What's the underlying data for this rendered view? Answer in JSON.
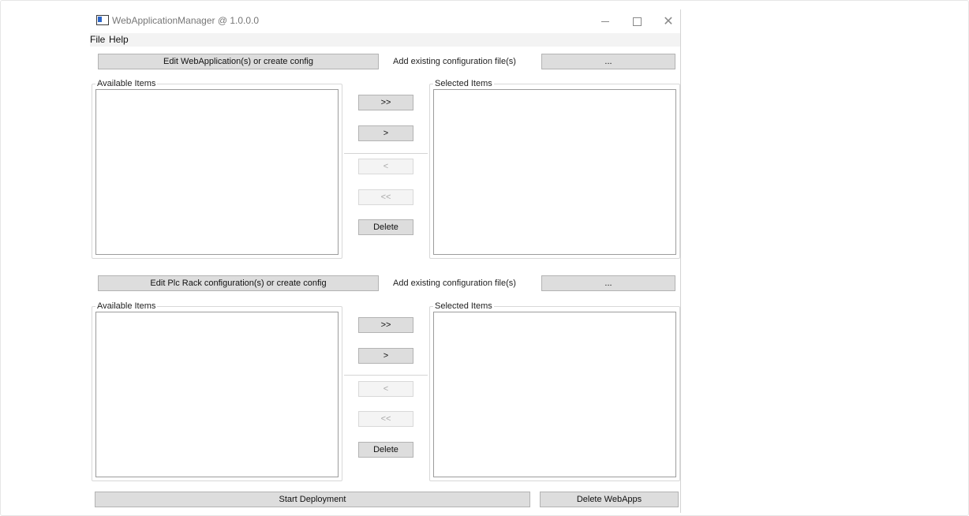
{
  "window": {
    "title": "WebApplicationManager @ 1.0.0.0",
    "close_glyph": "✕"
  },
  "menu": [
    {
      "label": "File"
    },
    {
      "label": "Help"
    }
  ],
  "webapp_section": {
    "edit_button": "Edit WebApplication(s) or create config",
    "add_existing_label": "Add existing configuration file(s)",
    "browse_button": "...",
    "available_legend": "Available Items",
    "selected_legend": "Selected Items",
    "move_all_right": ">>",
    "move_right": ">",
    "move_left": "<",
    "move_all_left": "<<",
    "delete_button": "Delete"
  },
  "plc_section": {
    "edit_button": "Edit Plc Rack configuration(s) or create config",
    "add_existing_label": "Add existing configuration file(s)",
    "browse_button": "...",
    "available_legend": "Available Items",
    "selected_legend": "Selected Items",
    "move_all_right": ">>",
    "move_right": ">",
    "move_left": "<",
    "move_all_left": "<<",
    "delete_button": "Delete"
  },
  "footer": {
    "start_button": "Start Deployment",
    "delete_webapps_button": "Delete WebApps"
  },
  "colors": {
    "button_face": "#dddddd",
    "button_border": "#b3b3b3",
    "disabled_text": "#a8a8a8",
    "icon_accent": "#2b65c8"
  },
  "icons": [
    "app-icon",
    "minimize-icon",
    "maximize-icon",
    "close-icon"
  ]
}
